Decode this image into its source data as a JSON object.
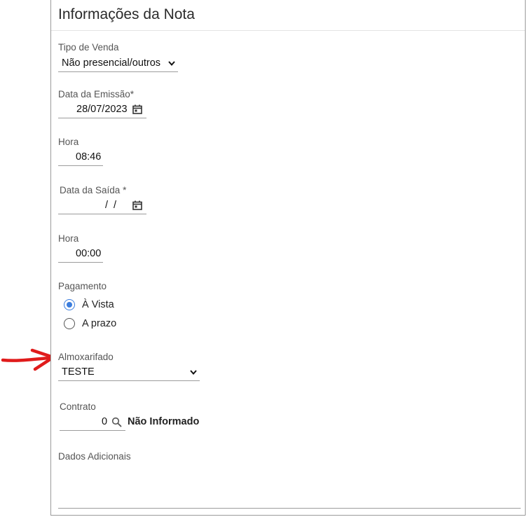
{
  "panel": {
    "title": "Informações da Nota"
  },
  "tipo_venda": {
    "label": "Tipo de Venda",
    "value": "Não presencial/outros"
  },
  "data_emissao": {
    "label": "Data da Emissão*",
    "value": "28/07/2023"
  },
  "hora_emissao": {
    "label": "Hora",
    "value": "08:46"
  },
  "data_saida": {
    "label": "Data da Saída *",
    "value": "/ /"
  },
  "hora_saida": {
    "label": "Hora",
    "value": "00:00"
  },
  "pagamento": {
    "label": "Pagamento",
    "options": [
      {
        "label": "À Vista",
        "checked": true
      },
      {
        "label": "A prazo",
        "checked": false
      }
    ]
  },
  "almoxarifado": {
    "label": "Almoxarifado",
    "value": "TESTE"
  },
  "contrato": {
    "label": "Contrato",
    "value": "0",
    "description": "Não Informado"
  },
  "dados_adicionais": {
    "label": "Dados Adicionais",
    "value": ""
  },
  "icons": {
    "select_chevron": "chevron-down-icon",
    "date_picker": "calendar-icon",
    "lookup": "search-icon",
    "annotation": "red-arrow-icon",
    "resize": "resize-grip-icon"
  },
  "colors": {
    "radio_accent": "#3b7ddd",
    "annotation_arrow": "#e01b1b"
  }
}
